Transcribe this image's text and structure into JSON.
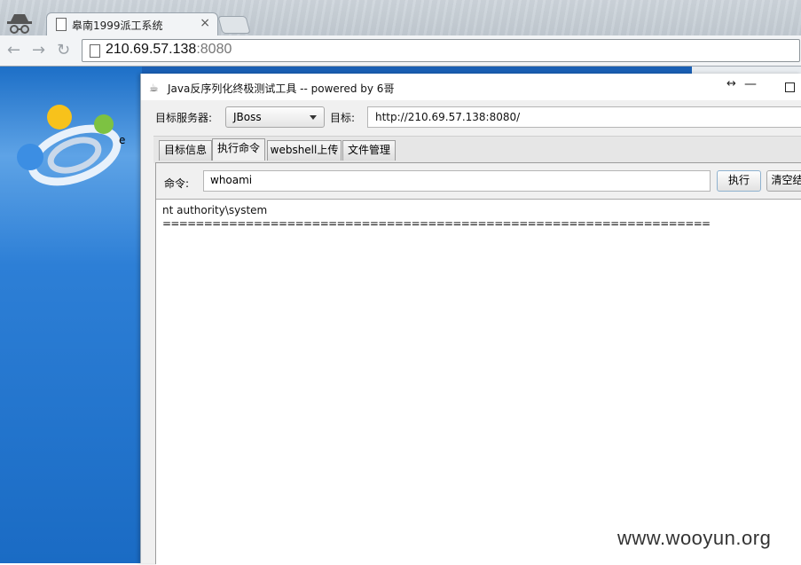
{
  "browser": {
    "tab_title": "皋南1999派工系统",
    "tab_close": "×",
    "url_host": "210.69.57.138",
    "url_port": ":8080"
  },
  "app": {
    "window_title": "Java反序列化终极测试工具  -- powered by 6哥",
    "server_label": "目标服务器:",
    "server_value": "JBoss",
    "target_label": "目标:",
    "target_value": "http://210.69.57.138:8080/",
    "tabs": [
      {
        "label": "目标信息"
      },
      {
        "label": "执行命令"
      },
      {
        "label": "webshell上传"
      },
      {
        "label": "文件管理"
      }
    ],
    "command_label": "命令:",
    "command_value": "whoami",
    "execute_label": "执行",
    "clear_label": "清空结",
    "output_lines": [
      "nt authority\\system",
      "=================================================================="
    ]
  },
  "site": {
    "logo_letter": "e"
  },
  "watermark": "www.wooyun.org"
}
